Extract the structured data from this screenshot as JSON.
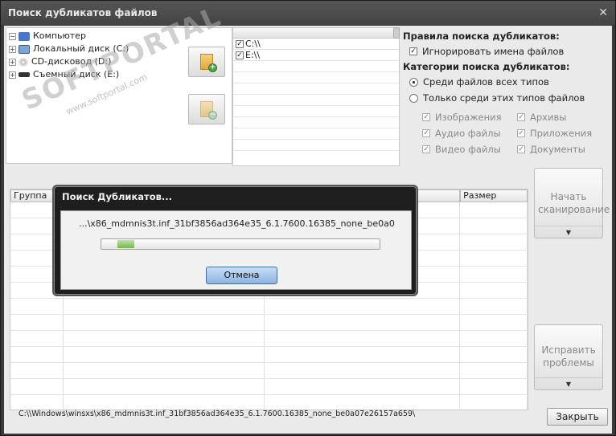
{
  "window": {
    "title": "Поиск дубликатов файлов",
    "close": "✕"
  },
  "tree": {
    "items": [
      {
        "label": "Компьютер",
        "icon": "computer-icon"
      },
      {
        "label": "Локальный диск (C:)",
        "icon": "hard-drive-icon"
      },
      {
        "label": "CD-дисковод (D:)",
        "icon": "cd-drive-icon"
      },
      {
        "label": "Съемный диск (E:)",
        "icon": "removable-drive-icon"
      }
    ]
  },
  "watermark": {
    "brand": "SOFTPORTAL",
    "tm": "TM",
    "url": "www.softportal.com"
  },
  "paths": {
    "items": [
      {
        "label": "C:\\\\",
        "checked": true
      },
      {
        "label": "E:\\\\",
        "checked": true
      }
    ]
  },
  "rules": {
    "title": "Правила поиска дубликатов:",
    "ignore_names": "Игнорировать имена файлов",
    "categories_title": "Категории поиска дубликатов:",
    "among_all": "Среди файлов всех типов",
    "only_these": "Только среди этих типов файлов",
    "types": {
      "images": "Изображения",
      "archives": "Архивы",
      "audio": "Аудио файлы",
      "apps": "Приложения",
      "video": "Видео файлы",
      "docs": "Документы"
    }
  },
  "buttons": {
    "start_scan": "Начать сканирование",
    "fix_problems": "Исправить проблемы",
    "close": "Закрыть"
  },
  "grid": {
    "columns": [
      "Группа",
      "",
      "",
      "Размер"
    ]
  },
  "status": "C:\\\\Windows\\winsxs\\x86_mdmnis3t.inf_31bf3856ad364e35_6.1.7600.16385_none_be0a07e26157a659\\",
  "modal": {
    "title": "Поиск Дубликатов...",
    "file": "...\\x86_mdmnis3t.inf_31bf3856ad364e35_6.1.7600.16385_none_be0a0",
    "progress": 0.06,
    "cancel": "Отмена"
  }
}
